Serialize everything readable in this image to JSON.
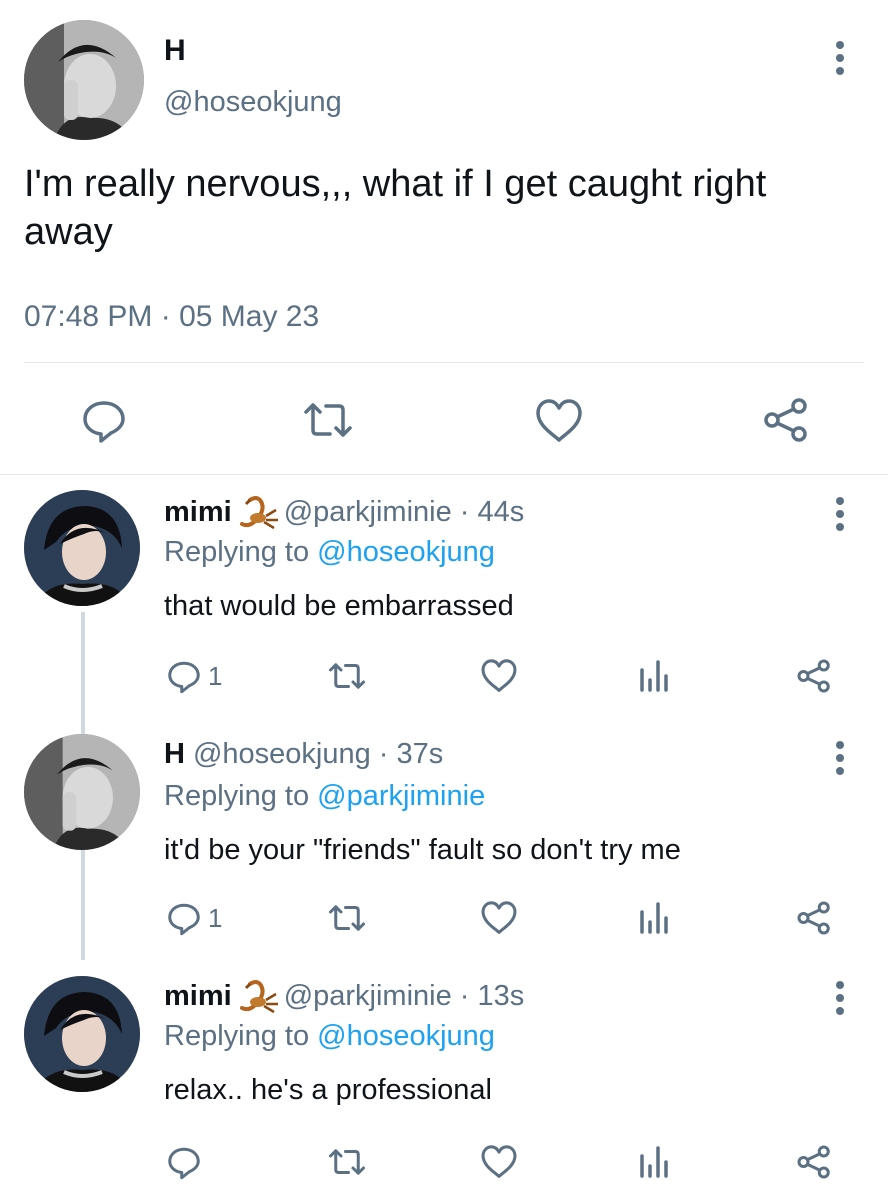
{
  "main_tweet": {
    "display_name": "H",
    "handle": "@hoseokjung",
    "text": "I'm really nervous,,, what if I get caught right away",
    "timestamp": "07:48 PM · 05 May 23",
    "actions": [
      "reply-icon",
      "retweet-icon",
      "like-icon",
      "share-icon"
    ]
  },
  "replies": [
    {
      "display_name": "mimi",
      "emoji": "scorpion-emoji",
      "handle_time": "@parkjiminie · 44s",
      "replying_prefix": "Replying to ",
      "replying_to": "@hoseokjung",
      "text": "that would be embarrassed",
      "reply_count": "1"
    },
    {
      "display_name": "H",
      "handle_time": "@hoseokjung · 37s",
      "replying_prefix": "Replying to ",
      "replying_to": "@parkjiminie",
      "text": "it'd be your \"friends\" fault so don't try me",
      "reply_count": "1"
    },
    {
      "display_name": "mimi",
      "emoji": "scorpion-emoji",
      "handle_time": "@parkjiminie · 13s",
      "replying_prefix": "Replying to ",
      "replying_to": "@hoseokjung",
      "text": "relax.. he's a professional",
      "reply_count": ""
    }
  ],
  "colors": {
    "text": "#0f1419",
    "secondary": "#5b7083",
    "link": "#1da1f2",
    "divider": "#e1e8ed",
    "thread_line": "#cfd9de"
  }
}
